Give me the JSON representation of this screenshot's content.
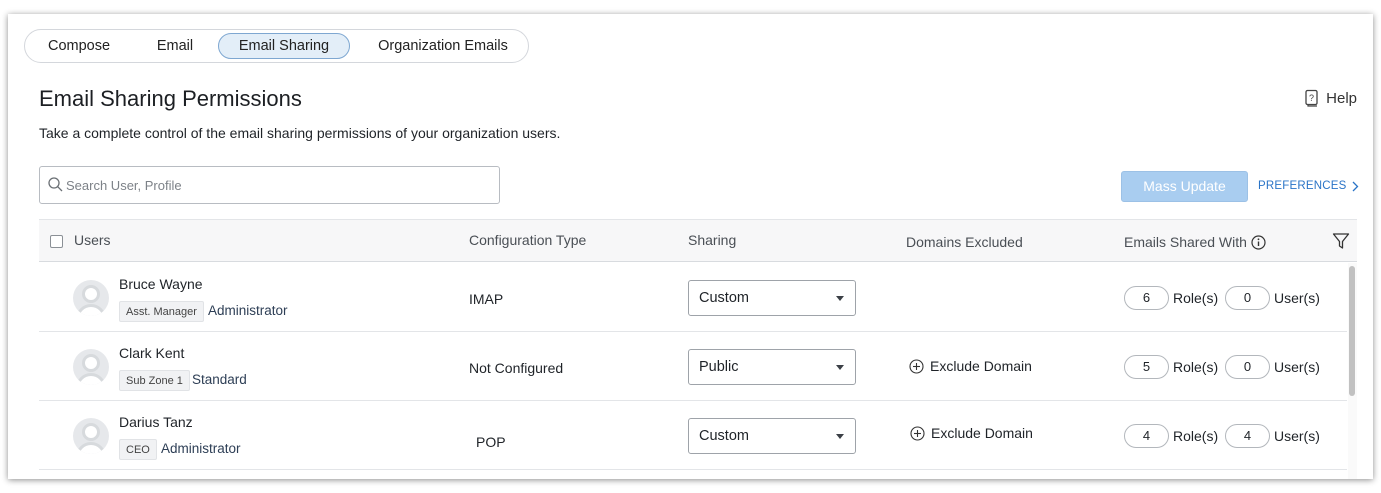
{
  "tabs": [
    {
      "label": "Compose",
      "active": false
    },
    {
      "label": "Email",
      "active": false
    },
    {
      "label": "Email Sharing",
      "active": true
    },
    {
      "label": "Organization Emails",
      "active": false
    }
  ],
  "page": {
    "title": "Email Sharing Permissions",
    "subtitle": "Take a complete control of the email sharing permissions of your organization users.",
    "help_label": "Help"
  },
  "search": {
    "placeholder": "Search User, Profile",
    "value": ""
  },
  "toolbar": {
    "mass_update_label": "Mass Update",
    "preferences_label": "PREFERENCES"
  },
  "table": {
    "columns": [
      "Users",
      "Configuration Type",
      "Sharing",
      "Domains Excluded",
      "Emails Shared With"
    ],
    "rows": [
      {
        "name": "Bruce Wayne",
        "role": "Asst. Manager",
        "profile": "Administrator",
        "config_type": "IMAP",
        "sharing": "Custom",
        "domains_excluded": "",
        "roles_count": "6",
        "roles_label": "Role(s)",
        "users_count": "0",
        "users_label": "User(s)"
      },
      {
        "name": "Clark Kent",
        "role": "Sub Zone 1",
        "profile": "Standard",
        "config_type": "Not Configured",
        "sharing": "Public",
        "domains_excluded": "Exclude Domain",
        "roles_count": "5",
        "roles_label": "Role(s)",
        "users_count": "0",
        "users_label": "User(s)"
      },
      {
        "name": "Darius Tanz",
        "role": "CEO",
        "profile": "Administrator",
        "config_type": "POP",
        "sharing": "Custom",
        "domains_excluded": "Exclude Domain",
        "roles_count": "4",
        "roles_label": "Role(s)",
        "users_count": "4",
        "users_label": "User(s)"
      }
    ]
  },
  "colors": {
    "accent": "#2a74c7",
    "mass_update_bg": "#a9cdf0",
    "active_tab_bg": "#e3eef8"
  },
  "icons": [
    "help-book-icon",
    "search-icon",
    "chevron-right-icon",
    "info-icon",
    "filter-icon",
    "avatar-icon",
    "plus-circle-icon",
    "caret-down-icon"
  ]
}
